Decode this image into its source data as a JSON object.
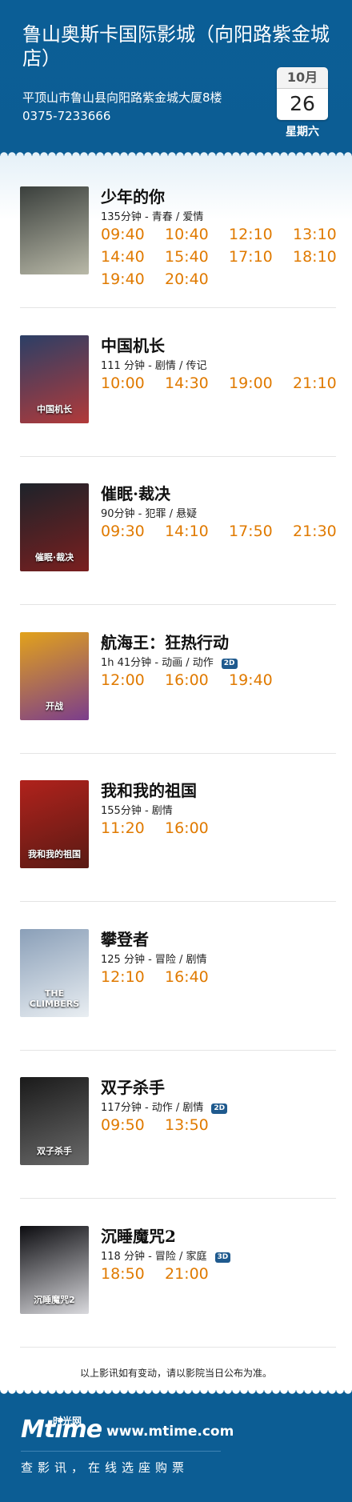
{
  "cinema": {
    "name": "鲁山奥斯卡国际影城（向阳路紫金城店）",
    "address": "平顶山市鲁山县向阳路紫金城大厦8楼",
    "phone": "0375-7233666"
  },
  "date": {
    "month": "10月",
    "day": "26",
    "weekday": "星期六"
  },
  "movies": [
    {
      "title": "少年的你",
      "meta": "135分钟 - 青春 / 爱情",
      "badge": "",
      "poster_caption": "",
      "poster_colors": [
        "#3a3f3c",
        "#b9b9a8"
      ],
      "times": [
        "09:40",
        "10:40",
        "12:10",
        "13:10",
        "14:40",
        "15:40",
        "17:10",
        "18:10",
        "19:40",
        "20:40"
      ]
    },
    {
      "title": "中国机长",
      "meta": "111 分钟 - 剧情 / 传记",
      "badge": "",
      "poster_caption": "中国机长",
      "poster_colors": [
        "#2b3f66",
        "#b23a3a"
      ],
      "times": [
        "10:00",
        "14:30",
        "19:00",
        "21:10"
      ]
    },
    {
      "title": "催眠·裁决",
      "meta": "90分钟 - 犯罪 / 悬疑",
      "badge": "",
      "poster_caption": "催眠·裁决",
      "poster_colors": [
        "#1d232a",
        "#7a1f1f"
      ],
      "times": [
        "09:30",
        "14:10",
        "17:50",
        "21:30"
      ]
    },
    {
      "title": "航海王：狂热行动",
      "meta": "1h 41分钟 - 动画 / 动作",
      "badge": "2D",
      "poster_caption": "开战",
      "poster_colors": [
        "#e2a21b",
        "#7b3d8c"
      ],
      "times": [
        "12:00",
        "16:00",
        "19:40"
      ]
    },
    {
      "title": "我和我的祖国",
      "meta": "155分钟 - 剧情",
      "badge": "",
      "poster_caption": "我和我的祖国",
      "poster_colors": [
        "#b0221c",
        "#5a1a14"
      ],
      "times": [
        "11:20",
        "16:00"
      ]
    },
    {
      "title": "攀登者",
      "meta": "125 分钟 - 冒险 / 剧情",
      "badge": "",
      "poster_caption": "THE CLIMBERS",
      "poster_colors": [
        "#8a9fb8",
        "#e9eef2"
      ],
      "times": [
        "12:10",
        "16:40"
      ]
    },
    {
      "title": "双子杀手",
      "meta": "117分钟 - 动作 / 剧情",
      "badge": "2D",
      "poster_caption": "双子杀手",
      "poster_colors": [
        "#1a1a1a",
        "#6a6a6a"
      ],
      "times": [
        "09:50",
        "13:50"
      ]
    },
    {
      "title": "沉睡魔咒2",
      "meta": "118 分钟 - 冒险 / 家庭",
      "badge": "3D",
      "poster_caption": "沉睡魔咒2",
      "poster_colors": [
        "#0c0c10",
        "#d9d9dd"
      ],
      "times": [
        "18:50",
        "21:00"
      ]
    }
  ],
  "notice": "以上影讯如有变动，请以影院当日公布为准。",
  "footer": {
    "logo": "Mtime",
    "logo_cn": "时光网",
    "site": "www.mtime.com",
    "slogan": "查影讯，在线选座购票"
  }
}
